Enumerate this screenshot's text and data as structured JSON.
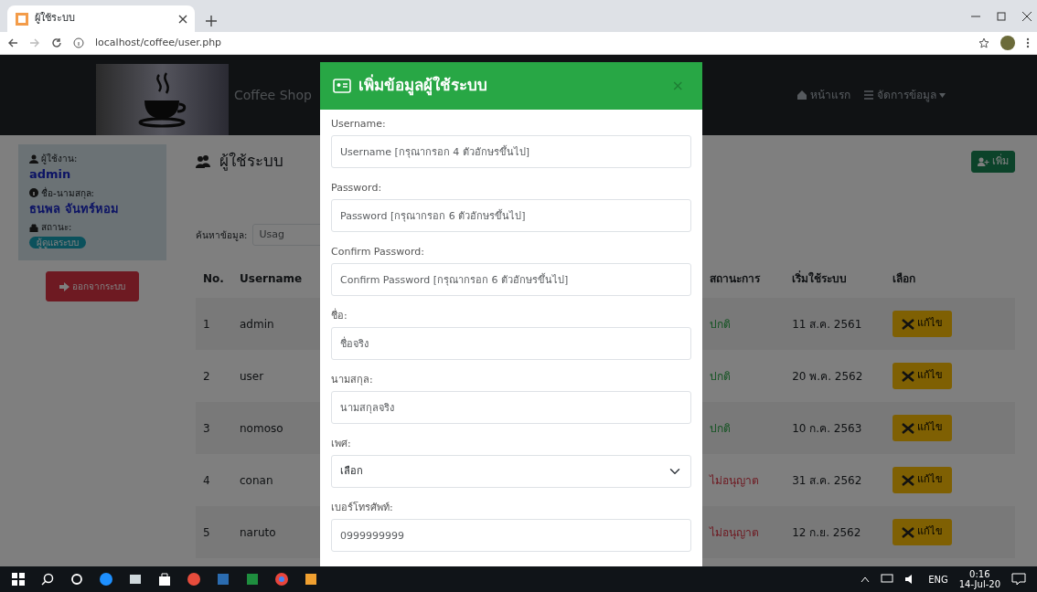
{
  "browser": {
    "tab_title": "ผู้ใช้ระบบ",
    "url": "localhost/coffee/user.php"
  },
  "navbar": {
    "brand": "Coffee Shop",
    "links": [
      {
        "label": "หน้าแรก",
        "kind": "link"
      },
      {
        "label": "จัดการข้อมูล",
        "kind": "dropdown"
      }
    ]
  },
  "sidebar": {
    "fields": [
      {
        "label": "ผู้ใช้งาน:",
        "value": "admin",
        "kind": "text"
      },
      {
        "label": "ชื่อ-นามสกุล:",
        "value": "ธนพล จันทร์หอม",
        "kind": "text"
      },
      {
        "label": "สถานะ:",
        "value": "ผู้ดูแลระบบ",
        "kind": "badge"
      }
    ],
    "logout": "ออกจากระบบ"
  },
  "main": {
    "heading": "ผู้ใช้ระบบ",
    "add_button": "เพิ่ม",
    "search_label": "ค้นหาข้อมูล:",
    "search_placeholder": "Usag"
  },
  "table": {
    "columns": [
      "No.",
      "Username",
      "สถานะการ",
      "เริ่มใช้ระบบ",
      "เลือก"
    ],
    "rows": [
      {
        "no": "1",
        "username": "admin",
        "status": "ปกติ",
        "allowed": true,
        "start": "11 ส.ค. 2561",
        "action": "แก้ไข"
      },
      {
        "no": "2",
        "username": "user",
        "status": "ปกติ",
        "allowed": true,
        "start": "20 พ.ค. 2562",
        "action": "แก้ไข"
      },
      {
        "no": "3",
        "username": "nomoso",
        "status": "ปกติ",
        "allowed": true,
        "start": "10 ก.ค. 2563",
        "action": "แก้ไข"
      },
      {
        "no": "4",
        "username": "conan",
        "status": "ไม่อนุญาต",
        "allowed": false,
        "start": "31 ส.ค. 2562",
        "action": "แก้ไข"
      },
      {
        "no": "5",
        "username": "naruto",
        "status": "ไม่อนุญาต",
        "allowed": false,
        "start": "12 ก.ย. 2562",
        "action": "แก้ไข"
      }
    ]
  },
  "modal": {
    "title": "เพิ่มข้อมูลผู้ใช้ระบบ",
    "close": "×",
    "fields": [
      {
        "label": "Username:",
        "placeholder": "Username [กรุณากรอก 4 ตัวอักษรขึ้นไป]",
        "kind": "input"
      },
      {
        "label": "Password:",
        "placeholder": "Password [กรุณากรอก 6 ตัวอักษรขึ้นไป]",
        "kind": "input"
      },
      {
        "label": "Confirm Password:",
        "placeholder": "Confirm Password [กรุณากรอก 6 ตัวอักษรขึ้นไป]",
        "kind": "input"
      },
      {
        "label": "ชื่อ:",
        "placeholder": "ชื่อจริง",
        "kind": "input"
      },
      {
        "label": "นามสกุล:",
        "placeholder": "นามสกุลจริง",
        "kind": "input"
      },
      {
        "label": "เพศ:",
        "value": "เลือก",
        "kind": "select"
      },
      {
        "label": "เบอร์โทรศัพท์:",
        "placeholder": "0999999999",
        "kind": "input"
      }
    ]
  },
  "taskbar": {
    "language": "ENG",
    "time": "0:16",
    "date": "14-Jul-20"
  }
}
